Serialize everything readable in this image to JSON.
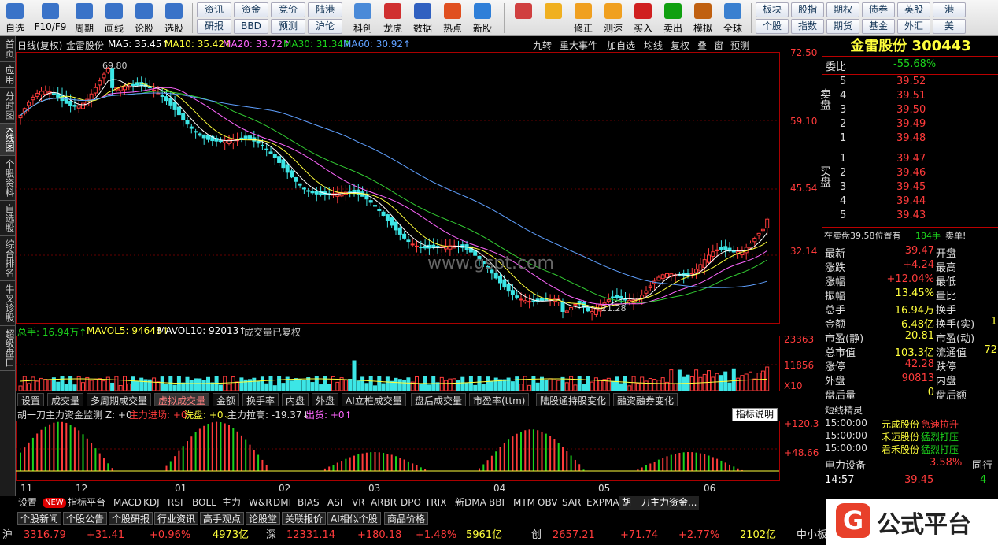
{
  "toolbar": {
    "items": [
      {
        "label": "自选",
        "icon": "star-icon",
        "color": "#3a73c8"
      },
      {
        "label": "F10/F9",
        "icon": "f10-icon",
        "color": "#3a73c8"
      },
      {
        "label": "周期",
        "icon": "clock-icon",
        "color": "#3a73c8"
      },
      {
        "label": "画线",
        "icon": "pen-icon",
        "color": "#3a73c8"
      },
      {
        "label": "论股",
        "icon": "discuss-icon",
        "color": "#3a73c8"
      },
      {
        "label": "选股",
        "icon": "select-stock-icon",
        "color": "#3a73c8"
      }
    ],
    "small_buttons": [
      [
        "资讯",
        "研报"
      ],
      [
        "资金",
        "BBD"
      ],
      [
        "竞价",
        "预测"
      ],
      [
        "陆港",
        "沪伦"
      ]
    ],
    "items2": [
      {
        "label": "科创",
        "icon": "kechuang-icon",
        "color": "#4a8ad8"
      },
      {
        "label": "龙虎",
        "icon": "dragon-tiger-icon",
        "color": "#d03030"
      },
      {
        "label": "数据",
        "icon": "pe-icon",
        "color": "#3060c0"
      },
      {
        "label": "热点",
        "icon": "hot-icon",
        "color": "#e05020"
      },
      {
        "label": "新股",
        "icon": "ipo-icon",
        "color": "#2f7fd8"
      }
    ],
    "items3": [
      {
        "label": "",
        "icon": "grid-icon",
        "color": "#d04040"
      },
      {
        "label": "",
        "icon": "back-arrow-icon",
        "color": "#f0b020"
      },
      {
        "label": "修正",
        "icon": "modify-icon",
        "color": "#f0a020"
      },
      {
        "label": "测速",
        "icon": "speed-icon",
        "color": "#f0a020"
      },
      {
        "label": "买入",
        "icon": "buy-icon",
        "color": "#d02020"
      },
      {
        "label": "卖出",
        "icon": "sell-icon",
        "color": "#10a010"
      },
      {
        "label": "模拟",
        "icon": "hammer-icon",
        "color": "#c06010"
      },
      {
        "label": "全球",
        "icon": "globe-icon",
        "color": "#3a80d0"
      }
    ],
    "right_buttons": [
      [
        "板块",
        "个股"
      ],
      [
        "股指",
        "指数"
      ],
      [
        "期权",
        "期货"
      ],
      [
        "债券",
        "基金"
      ],
      [
        "英股",
        "外汇"
      ],
      [
        "港",
        "美"
      ]
    ]
  },
  "left_tabs": [
    "首页",
    "应用",
    "分时图",
    "K线图",
    "个股资料",
    "自选股",
    "综合排名",
    "牛叉诊股",
    "超级盘口"
  ],
  "kline": {
    "header": {
      "period": "日线(复权)",
      "name": "金雷股份",
      "ma5": "MA5: 35.45↑",
      "ma10": "MA10: 35.42↑",
      "ma20": "MA20: 33.72↑",
      "ma30": "MA30: 31.34↑",
      "ma60": "MA60: 30.92↑"
    },
    "tools": [
      "九转",
      "重大事件",
      "加自选",
      "均线",
      "复权",
      "叠",
      "窗",
      "预测"
    ],
    "price_axis": [
      "72.50",
      "59.10",
      "45.54",
      "32.14"
    ],
    "high_label": "69.80",
    "low_label": "21.28",
    "watermark": "www.gspt.com",
    "colors": {
      "up": "#ff3b3b",
      "down": "#3ce6e6",
      "ma5": "#ffffff",
      "ma10": "#ffff3c",
      "ma20": "#ff66ff",
      "ma30": "#33cc33",
      "ma60": "#5fa0ff"
    }
  },
  "volume": {
    "header": {
      "total": "总手: 16.94万↑",
      "mavol5": "MAVOL5: 94648↑",
      "mavol10": "MAVOL10: 92013↑",
      "note": "成交量已复权"
    },
    "axis": [
      "23363",
      "11856",
      "X10"
    ]
  },
  "indicator_tabs": [
    "设置",
    "成交量",
    "多周期成交量",
    "虚拟成交量",
    "金额",
    "换手率",
    "内盘",
    "外盘",
    "AI立桩成交量",
    "盘后成交量",
    "市盈率(ttm)",
    "陆股通持股变化",
    "融资融券变化"
  ],
  "capital": {
    "title": "胡一刀主力资金监测 Z: +0",
    "l1": "主力进场: +0",
    "l2": "洗盘: +0↓",
    "l3": "主力拉高: -19.37↓",
    "l4": "出货: +0↑",
    "button": "指标说明",
    "axis": [
      "+120.3",
      "+48.66"
    ]
  },
  "months": [
    "11",
    "12",
    "01",
    "02",
    "03",
    "04",
    "05",
    "06"
  ],
  "bottom_tabs": [
    "设置",
    "NEW",
    "指标平台",
    "MACD",
    "KDJ",
    "RSI",
    "BOLL",
    "主力",
    "W&R",
    "DMI",
    "BIAS",
    "ASI",
    "VR",
    "ARBR",
    "DPO",
    "TRIX",
    "新DMA",
    "BBI",
    "MTM",
    "OBV",
    "SAR",
    "EXPMA",
    "胡一刀主力资金..."
  ],
  "news_tabs": [
    "个股新闻",
    "个股公告",
    "个股研报",
    "行业资讯",
    "高手观点",
    "论股堂",
    "关联报价",
    "AI相似个股",
    "商品价格"
  ],
  "status": [
    {
      "idx": "沪",
      "val": "3316.79",
      "chg": "+31.41",
      "pct": "+0.96%",
      "amt": "4973亿"
    },
    {
      "idx": "深",
      "val": "12331.14",
      "chg": "+180.18",
      "pct": "+1.48%",
      "amt": "5961亿"
    },
    {
      "idx": "创",
      "val": "2657.21",
      "chg": "+71.74",
      "pct": "+2.77%",
      "amt": "2102亿"
    }
  ],
  "status_tail": "中小板",
  "quote": {
    "title": "金雷股份 300443",
    "weibi_label": "委比",
    "weibi": "-55.68%",
    "sell": [
      [
        "5",
        "39.52"
      ],
      [
        "4",
        "39.51"
      ],
      [
        "3",
        "39.50"
      ],
      [
        "2",
        "39.49"
      ],
      [
        "1",
        "39.48"
      ]
    ],
    "buy": [
      [
        "1",
        "39.47"
      ],
      [
        "2",
        "39.46"
      ],
      [
        "3",
        "39.45"
      ],
      [
        "4",
        "39.44"
      ],
      [
        "5",
        "39.43"
      ]
    ],
    "sell_label": "卖盘",
    "buy_label": "买盘",
    "pending": "在卖盘39.58位置有",
    "pending_qty": "184手",
    "pending_flag": "卖单!",
    "stats": [
      [
        "最新",
        "39.47",
        "开盘",
        ""
      ],
      [
        "涨跌",
        "+4.24",
        "最高",
        ""
      ],
      [
        "涨幅",
        "+12.04%",
        "最低",
        ""
      ],
      [
        "振幅",
        "13.45%",
        "量比",
        ""
      ],
      [
        "总手",
        "16.94万",
        "换手",
        ""
      ],
      [
        "金额",
        "6.48亿",
        "换手(实)",
        "1"
      ],
      [
        "市盈(静)",
        "20.81",
        "市盈(动)",
        ""
      ],
      [
        "总市值",
        "103.3亿",
        "流通值",
        "72"
      ],
      [
        "涨停",
        "42.28",
        "跌停",
        ""
      ],
      [
        "外盘",
        "90813",
        "内盘",
        ""
      ],
      [
        "盘后量",
        "0",
        "盘后额",
        ""
      ]
    ],
    "short_title": "短线精灵",
    "short": [
      [
        "15:00:00",
        "元成股份",
        "急速拉升"
      ],
      [
        "15:00:00",
        "禾迈股份",
        "猛烈打压"
      ],
      [
        "15:00:00",
        "君禾股份",
        "猛烈打压"
      ]
    ],
    "sector": "电力设备",
    "sector_pct": "3.58%",
    "sector_tail": "同行",
    "time": "14:57",
    "last_price": "39.45",
    "last_qty": "4"
  },
  "logo_text": "公式平台"
}
